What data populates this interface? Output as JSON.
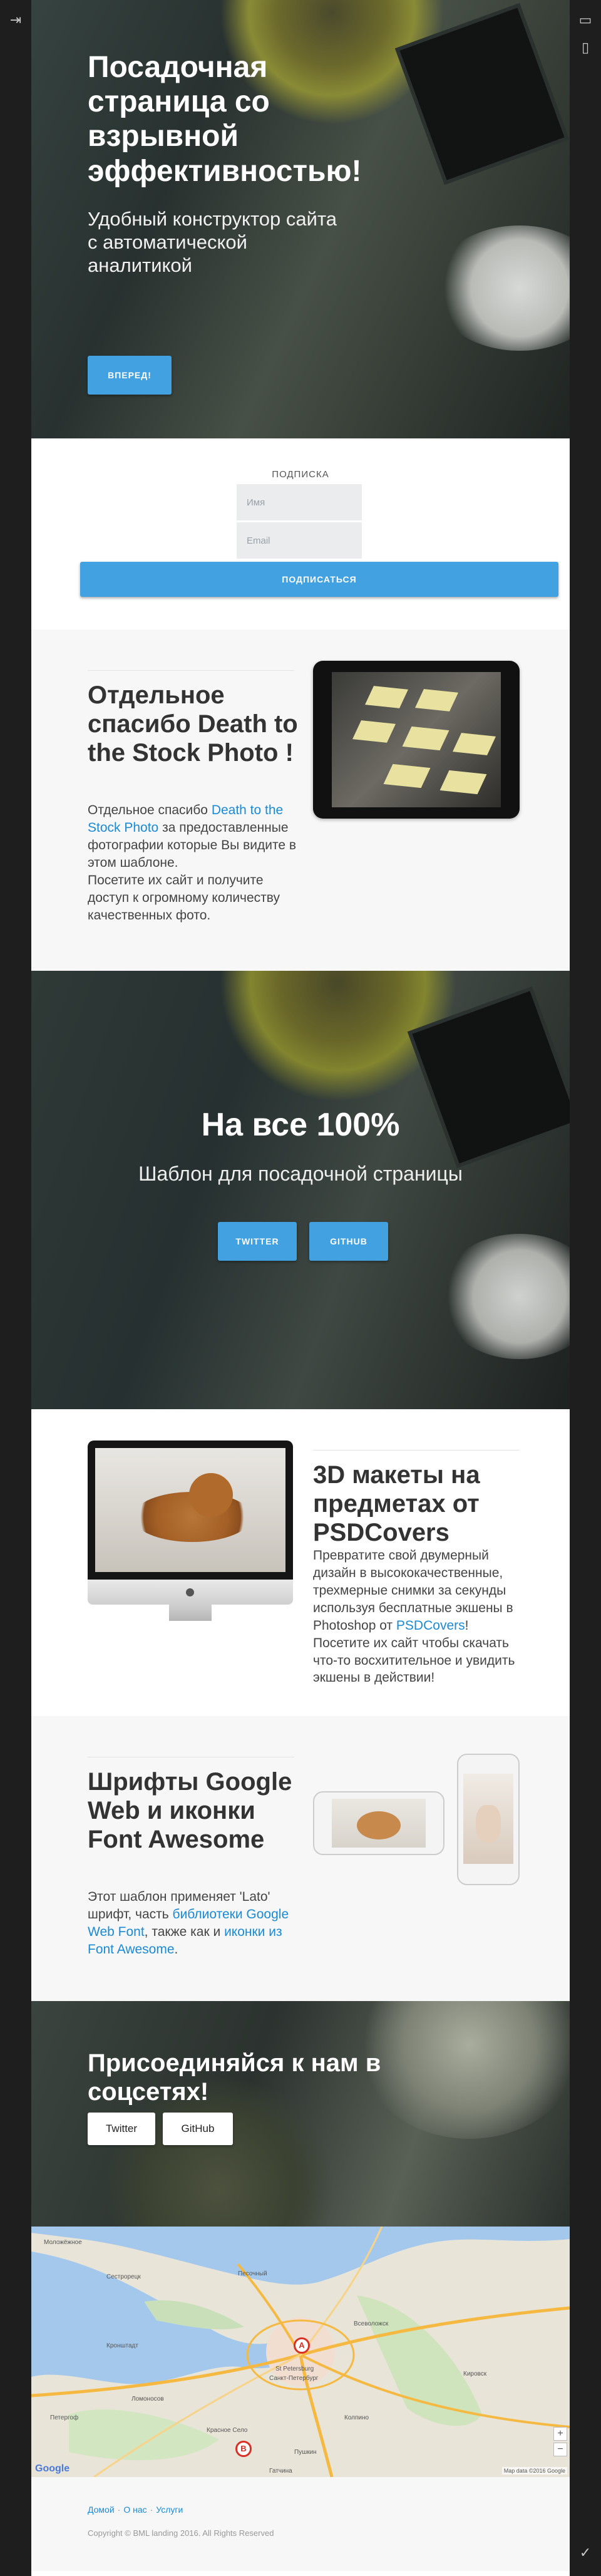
{
  "toolbar": {
    "left_icon": "sign-in-icon",
    "right_icons": [
      "desktop-icon",
      "mobile-icon"
    ],
    "bottom_icon": "check-icon"
  },
  "hero": {
    "title": "Посадочная страница со взрывной эффективностью!",
    "subtitle": "Удобный конструктор сайта с автоматической аналитикой",
    "button": "ВПЕРЕД!"
  },
  "subscribe": {
    "label": "ПОДПИСКА",
    "name_placeholder": "Имя",
    "email_placeholder": "Email",
    "button": "ПОДПИСАТЬСЯ"
  },
  "feature1": {
    "title": "Отдельное спасибо Death to the Stock Photo !",
    "body_prefix": "Отдельное спасибо ",
    "body_link": "Death to the Stock Photo",
    "body_suffix": " за предоставленные фотографии которые Вы видите в этом шаблоне.",
    "body_line2": "Посетите их сайт и получите доступ к огромному количеству качественных фото."
  },
  "banner": {
    "title": "На все 100%",
    "subtitle": "Шаблон для посадочной страницы",
    "buttons": [
      "TWITTER",
      "GITHUB"
    ]
  },
  "feature2": {
    "title": "3D макеты на предметах от PSDCovers",
    "body_prefix": "Превратите свой двумерный дизайн в высококачественные, трехмерные снимки за секунды используя бесплатные экшены в Photoshop от ",
    "body_link": "PSDCovers",
    "body_suffix": "! Посетите их сайт чтобы скачать что-то восхитительное и увидить экшены в действии!"
  },
  "feature3": {
    "title": "Шрифты Google Web и иконки Font Awesome",
    "body_prefix": "Этот шаблон применяет 'Lato' шрифт, часть ",
    "body_link1": "библиотеки Google Web Font",
    "body_middle": ", также как и ",
    "body_link2": "иконки из Font Awesome",
    "body_suffix": "."
  },
  "social": {
    "title": "Присоединяйся к нам в соцсетях!",
    "buttons": [
      "Twitter",
      "GitHub"
    ]
  },
  "map": {
    "labels": [
      "Моложёжное",
      "Сестрорецк",
      "Песочный",
      "Всеволожск",
      "Санкт-Петербург",
      "St Petersburg",
      "Кронштадт",
      "Петергоф",
      "Красное Село",
      "Колпино",
      "Пушкин",
      "Гатчина",
      "Ломоносов",
      "Кировск"
    ],
    "markers": [
      "A",
      "B"
    ],
    "zoom_in": "+",
    "zoom_out": "−",
    "logo": "Google",
    "attribution": "Map data ©2016 Google"
  },
  "footer": {
    "links": [
      "Домой",
      "О нас",
      "Услуги"
    ],
    "separator": "·",
    "copyright": "Copyright © BML landing 2016. All Rights Reserved"
  },
  "colors": {
    "accent": "#42a1e1",
    "link": "#1a8ad6",
    "chrome": "#1e1e1e"
  }
}
